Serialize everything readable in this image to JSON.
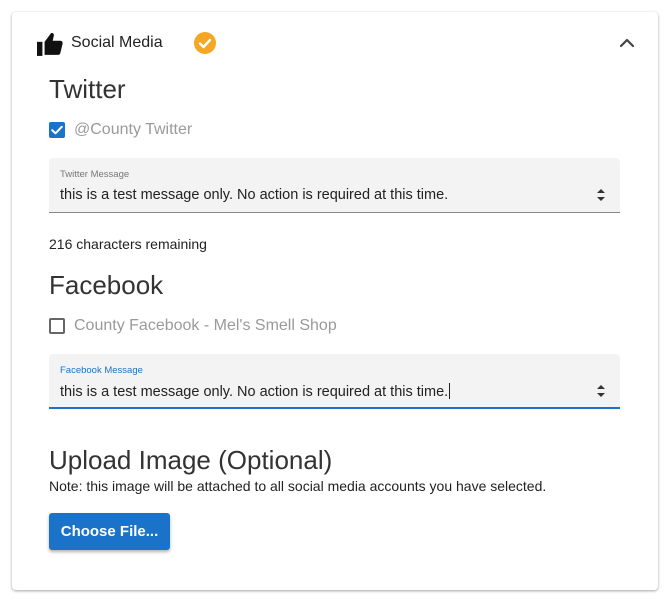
{
  "header": {
    "title": "Social Media",
    "icon": "thumbs-up-icon",
    "status_icon": "check-circle-icon",
    "status_color": "#f5a623",
    "toggle_icon": "chevron-up-icon"
  },
  "twitter": {
    "section_title": "Twitter",
    "account_label": "@County Twitter",
    "account_checked": true,
    "message_label": "Twitter Message",
    "message_value": "this is a test message only. No action is required at this time.",
    "remaining_text": "216 characters remaining"
  },
  "facebook": {
    "section_title": "Facebook",
    "account_label": "County Facebook - Mel's Smell Shop",
    "account_checked": false,
    "message_label": "Facebook Message",
    "message_value": "this is a test message only. No action is required at this time."
  },
  "upload": {
    "title": "Upload Image (Optional)",
    "note": "Note: this image will be attached to all social media accounts you have selected.",
    "button_label": "Choose File..."
  },
  "colors": {
    "accent": "#1a73c8",
    "badge": "#f5a623"
  }
}
